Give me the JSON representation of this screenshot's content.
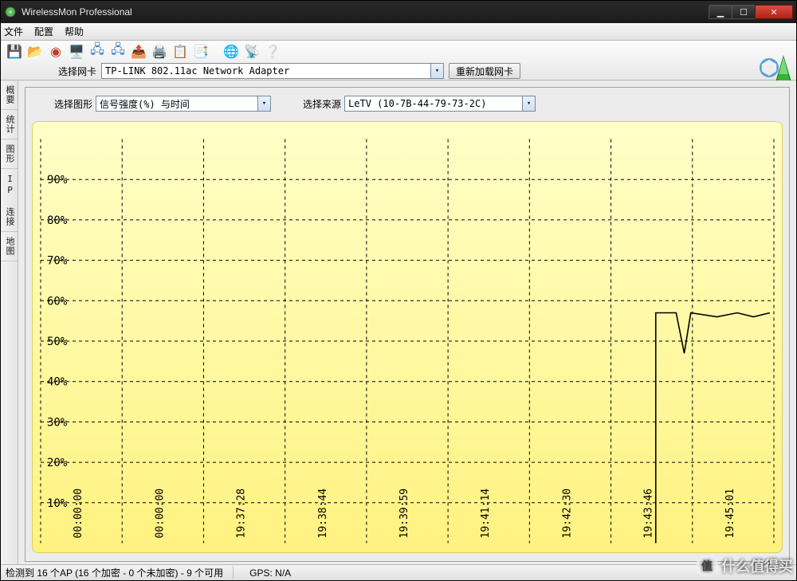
{
  "window": {
    "title": "WirelessMon Professional"
  },
  "menu": {
    "file": "文件",
    "config": "配置",
    "help": "帮助"
  },
  "toolbar": {
    "adapter_label": "选择网卡",
    "adapter_value": "TP-LINK 802.11ac Network Adapter",
    "reload_button": "重新加载网卡"
  },
  "side_tabs": [
    "概要",
    "统计",
    "图形",
    "IP 连接",
    "地图"
  ],
  "panel": {
    "select_chart_label": "选择图形",
    "select_chart_value": "信号强度(%) 与时间",
    "select_source_label": "选择来源",
    "select_source_value": "LeTV (10-7B-44-79-73-2C)"
  },
  "chart_data": {
    "type": "line",
    "ylabel": "",
    "xlabel": "",
    "ylim": [
      0,
      100
    ],
    "y_ticks": [
      "10%",
      "20%",
      "30%",
      "40%",
      "50%",
      "60%",
      "70%",
      "80%",
      "90%"
    ],
    "x_ticks": [
      "00:00:00",
      "00:00:00",
      "19:37:28",
      "19:38:44",
      "19:39:59",
      "19:41:14",
      "19:42:30",
      "19:43:46",
      "19:45:01"
    ],
    "series": [
      {
        "name": "signal",
        "points": [
          {
            "xi": 7.55,
            "y": 0
          },
          {
            "xi": 7.55,
            "y": 57
          },
          {
            "xi": 7.8,
            "y": 57
          },
          {
            "xi": 7.9,
            "y": 47
          },
          {
            "xi": 7.98,
            "y": 57
          },
          {
            "xi": 8.3,
            "y": 56
          },
          {
            "xi": 8.55,
            "y": 57
          },
          {
            "xi": 8.75,
            "y": 56
          },
          {
            "xi": 8.95,
            "y": 57
          }
        ]
      }
    ]
  },
  "status": {
    "ap_summary": "检测到 16 个AP (16 个加密 - 0 个未加密) - 9 个可用",
    "gps": "GPS: N/A"
  },
  "watermark": {
    "text": "什么值得买",
    "badge": "值"
  }
}
